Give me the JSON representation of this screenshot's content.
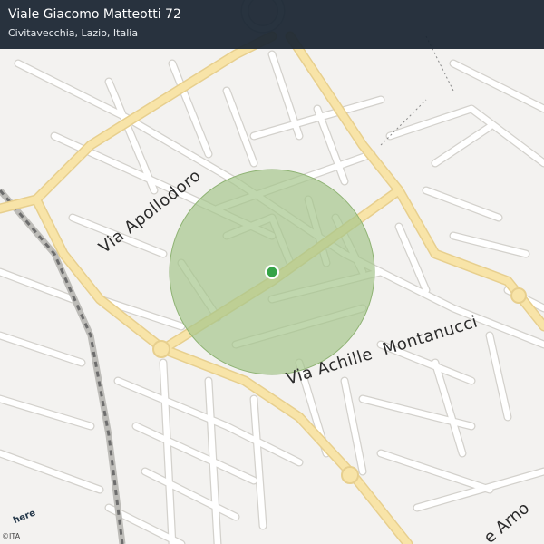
{
  "header": {
    "title": "Viale Giacomo Matteotti 72",
    "subtitle": "Civitavecchia, Lazio, Italia"
  },
  "map": {
    "street_labels": {
      "apollodoro": "Via Apollodoro",
      "montanucci": "Via Achille  Montanucci",
      "arno": "e Arno"
    },
    "colors": {
      "background": "#f3f2f0",
      "minor_road": "#ffffff",
      "road_casing": "#d3d1cc",
      "major_road": "#f8e4a8",
      "major_road_casing": "#e7cf8e",
      "accuracy_circle": "#a5c68b",
      "marker": "#36a347",
      "header_bg": "#182330"
    }
  },
  "branding": {
    "logo": "here",
    "copyright": "©ITA"
  }
}
